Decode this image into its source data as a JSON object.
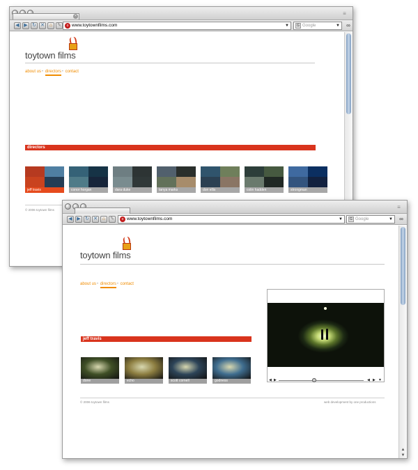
{
  "colors": {
    "accent_orange": "#f08c00",
    "accent_red": "#d9341d",
    "thumb_label_gray": "#a7a7a7",
    "selected_label": "#e64b1d"
  },
  "window1": {
    "url": "www.toytownfilms.com",
    "search_placeholder": "Google",
    "logo_text": "toytown films",
    "nav": [
      "about us",
      "directors",
      "contact"
    ],
    "active_nav": "directors",
    "section_title": "directors",
    "directors": [
      {
        "name": "jeff travis",
        "selected": true,
        "colors": [
          "#b63a20",
          "#4f7fa2",
          "#c9431f",
          "#243d55"
        ]
      },
      {
        "name": "conor horgan",
        "selected": false,
        "colors": [
          "#356277",
          "#163346",
          "#4f7b88",
          "#17253a"
        ]
      },
      {
        "name": "dara duke",
        "selected": false,
        "colors": [
          "#6e7e82",
          "#2d3434",
          "#7a8c8f",
          "#303838"
        ]
      },
      {
        "name": "tanya marks",
        "selected": false,
        "colors": [
          "#51606d",
          "#2a2f2c",
          "#62715a",
          "#a78c6b"
        ]
      },
      {
        "name": "don ellis",
        "selected": false,
        "colors": [
          "#30546c",
          "#6f7f5b",
          "#2b4052",
          "#8a7564"
        ]
      },
      {
        "name": "colin hadden",
        "selected": false,
        "colors": [
          "#2d3e3a",
          "#465940",
          "#6a7a6d",
          "#202824"
        ]
      },
      {
        "name": "strongman",
        "selected": false,
        "colors": [
          "#3f6aa0",
          "#0b2f61",
          "#33547e",
          "#12213f"
        ]
      }
    ],
    "footer": "© 2006 toytown films"
  },
  "window2": {
    "url": "www.toytownfilms.com",
    "search_placeholder": "Google",
    "logo_text": "toytown films",
    "nav": [
      "about us",
      "directors",
      "contact"
    ],
    "active_nav": "directors",
    "section_title": "jeff travis",
    "films": [
      {
        "title": "done",
        "color": "#3f4f26"
      },
      {
        "title": "echo",
        "color": "#8c7d40"
      },
      {
        "title": "scott cornell",
        "color": "#2d4458"
      },
      {
        "title": "godness",
        "color": "#3f6d8f"
      }
    ],
    "video_progress": 0.42,
    "footer_left": "© 2006 toytown films",
    "footer_right": "web development by one productions"
  }
}
